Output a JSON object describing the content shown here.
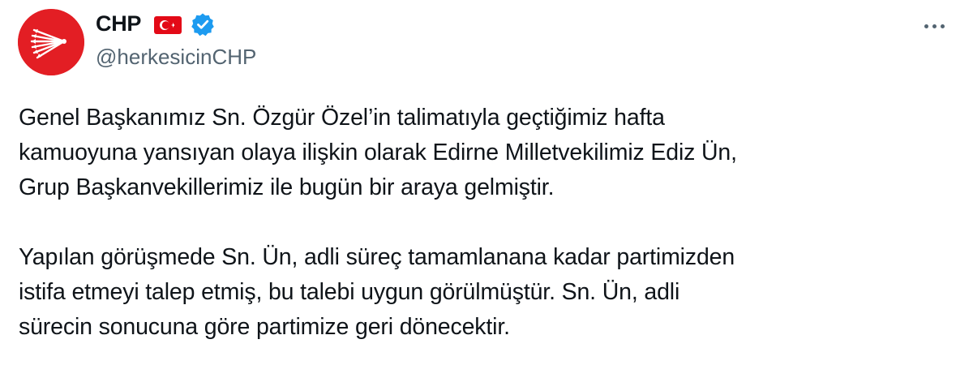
{
  "tweet": {
    "author": {
      "name": "CHP",
      "handle": "@herkesicinCHP",
      "flag_icon": "turkey-flag-icon",
      "verified_icon": "verified-badge-icon",
      "avatar_icon": "chp-six-arrows-logo"
    },
    "more_icon": "more-options-icon",
    "paragraphs": [
      "Genel Başkanımız Sn. Özgür Özel’in talimatıyla geçtiğimiz hafta\nkamuoyuna yansıyan olaya ilişkin olarak Edirne Milletvekilimiz Ediz Ün,\nGrup Başkanvekillerimiz ile bugün bir araya gelmiştir.",
      "Yapılan görüşmede Sn. Ün, adli süreç tamamlanana kadar partimizden\nistifa etmeyi talep etmiş, bu talebi uygun görülmüştür. Sn. Ün, adli\nsürecin sonucuna göre partimize geri dönecektir."
    ]
  },
  "colors": {
    "text": "#0f1419",
    "secondary": "#536471",
    "brand_red": "#e31e24",
    "verified_blue": "#1d9bf0"
  }
}
